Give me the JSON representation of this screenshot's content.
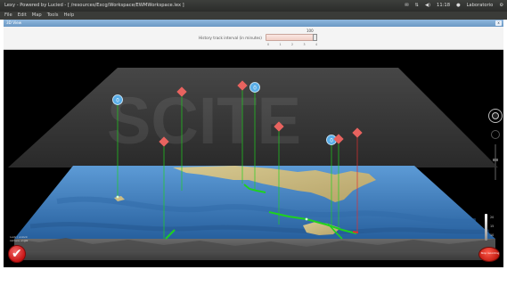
{
  "titlebar": {
    "title": "Lexy - Powered by Lucied - [ /resources/Excg/Workspace/EWMWorkspace.lex ]",
    "clock": "11:18",
    "user": "Laboratorio"
  },
  "menu": [
    "File",
    "Edit",
    "Map",
    "Tools",
    "Help"
  ],
  "subwindow": {
    "title": "3D View",
    "close_label": "x"
  },
  "history": {
    "label": "History track interval (in minutes)",
    "max": "100",
    "ticks": [
      "0",
      "1",
      "2",
      "3",
      "4"
    ]
  },
  "controls": {
    "lock_label": "Lock / unlock camera angle",
    "record_label": "Stop recording",
    "depth_ticks": [
      "20",
      "15",
      "10"
    ]
  },
  "icons": {
    "navigator": "compass-icon",
    "lock": "check-icon",
    "record": "record-icon",
    "vessel": "vessel-icon",
    "marker": "diamond-icon"
  },
  "colors": {
    "titlebar": "#2b2c2a",
    "accent": "#6b98c4",
    "sea": "#3a78b8",
    "land": "#c9b87d",
    "track": "#1fd11f",
    "marker": "#e8635f",
    "vessel": "#5aaee8"
  },
  "markers": [
    {
      "kind": "vessel",
      "label": "0"
    },
    {
      "kind": "diamond",
      "label": ""
    },
    {
      "kind": "diamond",
      "label": ""
    },
    {
      "kind": "vessel",
      "label": "0"
    },
    {
      "kind": "diamond",
      "label": ""
    },
    {
      "kind": "diamond",
      "label": ""
    },
    {
      "kind": "vessel",
      "label": "0"
    },
    {
      "kind": "diamond",
      "label": ""
    },
    {
      "kind": "diamond",
      "label": ""
    }
  ]
}
